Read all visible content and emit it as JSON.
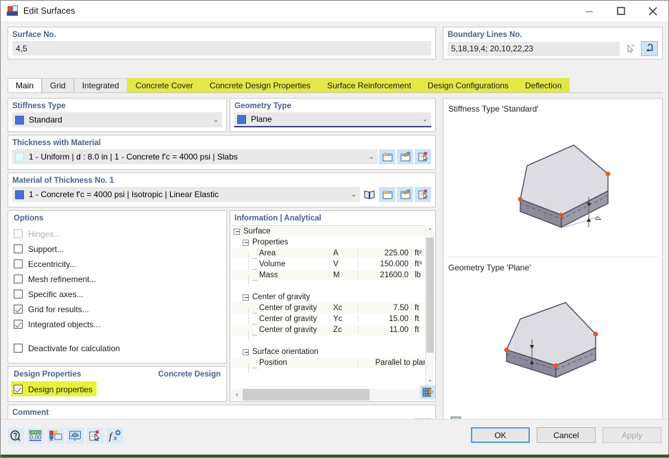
{
  "window": {
    "title": "Edit Surfaces",
    "icon": "edit-surfaces-icon",
    "minimize": "–",
    "maximize": "□",
    "close": "✕"
  },
  "surface_no": {
    "label": "Surface No.",
    "value": "4,5"
  },
  "boundary_lines": {
    "label": "Boundary Lines No.",
    "value": "5,18,19,4; 20,10,22,23",
    "pick_icon": "select-pointer-icon",
    "reverse_icon": "reverse-arrow-icon"
  },
  "tabs": [
    {
      "label": "Main",
      "state": "active"
    },
    {
      "label": "Grid",
      "state": "normal"
    },
    {
      "label": "Integrated",
      "state": "normal"
    },
    {
      "label": "Concrete Cover",
      "state": "highlight"
    },
    {
      "label": "Concrete Design Properties",
      "state": "highlight"
    },
    {
      "label": "Surface Reinforcement",
      "state": "highlight"
    },
    {
      "label": "Design Configurations",
      "state": "highlight"
    },
    {
      "label": "Deflection",
      "state": "highlight"
    }
  ],
  "stiffness": {
    "label": "Stiffness Type",
    "value": "Standard",
    "swatch_color": "#4472d8",
    "chevron": "⌄"
  },
  "geometry": {
    "label": "Geometry Type",
    "value": "Plane",
    "swatch_color": "#4472d8",
    "chevron": "⌄"
  },
  "thickness": {
    "label": "Thickness with Material",
    "value": "1 - Uniform | d : 8.0 in | 1 - Concrete f'c = 4000 psi | Slabs",
    "swatch_color": "#ddfcfb",
    "chevron": "⌄",
    "icons": [
      "new-thickness-icon",
      "edit-thickness-icon",
      "delete-thickness-icon"
    ]
  },
  "material": {
    "label": "Material of Thickness No. 1",
    "value": "1 - Concrete f'c = 4000 psi | Isotropic | Linear Elastic",
    "swatch_color": "#4472d8",
    "chevron": "⌄",
    "icons": [
      "material-library-icon",
      "new-material-icon",
      "edit-material-icon",
      "delete-material-icon"
    ]
  },
  "options": {
    "label": "Options",
    "items": [
      {
        "label": "Hinges...",
        "checked": false,
        "disabled": true
      },
      {
        "label": "Support...",
        "checked": false,
        "disabled": false
      },
      {
        "label": "Eccentricity...",
        "checked": false,
        "disabled": false
      },
      {
        "label": "Mesh refinement...",
        "checked": false,
        "disabled": false
      },
      {
        "label": "Specific axes...",
        "checked": false,
        "disabled": false
      },
      {
        "label": "Grid for results...",
        "checked": true,
        "disabled": false
      },
      {
        "label": "Integrated objects...",
        "checked": true,
        "disabled": false
      }
    ],
    "deactivate": {
      "label": "Deactivate for calculation",
      "checked": false
    }
  },
  "design_properties": {
    "label": "Design Properties",
    "right_label": "Concrete Design",
    "checkbox": {
      "label": "Design properties",
      "checked": true,
      "highlighted": true
    },
    "highlight_color": "#e8f13c"
  },
  "information": {
    "title": "Information | Analytical",
    "rows": [
      {
        "kind": "group",
        "indent": 0,
        "name": "Surface"
      },
      {
        "kind": "group",
        "indent": 1,
        "name": "Properties"
      },
      {
        "kind": "item",
        "indent": 2,
        "name": "Area",
        "sym": "A",
        "val": "225.00",
        "unit": "ft²"
      },
      {
        "kind": "item",
        "indent": 2,
        "name": "Volume",
        "sym": "V",
        "val": "150.000",
        "unit": "ft³"
      },
      {
        "kind": "item",
        "indent": 2,
        "name": "Mass",
        "sym": "M",
        "val": "21600.0",
        "unit": "lb"
      },
      {
        "kind": "blank"
      },
      {
        "kind": "group",
        "indent": 1,
        "name": "Center of gravity"
      },
      {
        "kind": "item",
        "indent": 2,
        "name": "Center of gravity",
        "sym": "Xc",
        "val": "7.50",
        "unit": "ft"
      },
      {
        "kind": "item",
        "indent": 2,
        "name": "Center of gravity",
        "sym": "Yc",
        "val": "15.00",
        "unit": "ft"
      },
      {
        "kind": "item",
        "indent": 2,
        "name": "Center of gravity",
        "sym": "Zc",
        "val": "11.00",
        "unit": "ft"
      },
      {
        "kind": "blank"
      },
      {
        "kind": "group",
        "indent": 1,
        "name": "Surface orientation"
      },
      {
        "kind": "item-wide",
        "indent": 2,
        "name": "Position",
        "sym": "",
        "val": "Parallel to plane",
        "unit": ""
      }
    ],
    "scroll_up": "⌃",
    "scroll_down": "⌄",
    "scroll_left": "‹",
    "scroll_right": "›",
    "footer_icon": "grid-properties-icon"
  },
  "comment": {
    "label": "Comment",
    "value": "",
    "placeholder": "",
    "chevron": "⌄",
    "button_icon": "comment-copy-icon"
  },
  "preview": {
    "top_label": "Stiffness Type 'Standard'",
    "bottom_label": "Geometry Type 'Plane'",
    "dimension_symbol": "d",
    "footer_icon": "render-view-icon",
    "slab_fill": "#dcdce2",
    "slab_side": "#8a8a9a",
    "node_color": "#e8552a"
  },
  "footer": {
    "icons": [
      "help-icon",
      "number-format-icon",
      "display-properties-icon",
      "visibility-icon",
      "delete-selection-icon",
      "formula-icon"
    ],
    "buttons": [
      {
        "label": "OK",
        "state": "primary"
      },
      {
        "label": "Cancel",
        "state": "normal"
      },
      {
        "label": "Apply",
        "state": "disabled"
      }
    ]
  }
}
